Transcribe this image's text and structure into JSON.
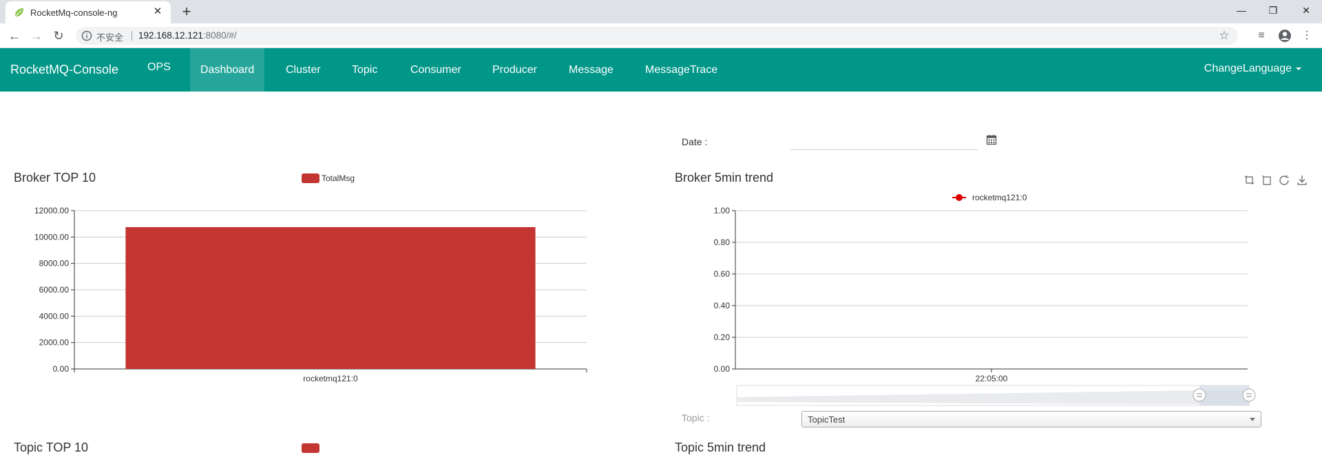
{
  "browser": {
    "tab_title": "RocketMq-console-ng",
    "url_insecure_label": "不安全",
    "url_host": "192.168.12.121",
    "url_path": ":8080/#/"
  },
  "navbar": {
    "brand": "RocketMQ-Console",
    "items": [
      {
        "label": "OPS"
      },
      {
        "label": "Dashboard",
        "active": true
      },
      {
        "label": "Cluster"
      },
      {
        "label": "Topic"
      },
      {
        "label": "Consumer"
      },
      {
        "label": "Producer"
      },
      {
        "label": "Message"
      },
      {
        "label": "MessageTrace"
      }
    ],
    "language": "ChangeLanguage"
  },
  "date_filter": {
    "label": "Date :",
    "value": ""
  },
  "topic_filter": {
    "label": "Topic :",
    "selected": "TopicTest"
  },
  "colors": {
    "navbar": "#009688",
    "navbar_active": "#26a69a",
    "bar": "#c23531",
    "trend_line": "#e00000"
  },
  "chart_data": [
    {
      "type": "bar",
      "title": "Broker TOP 10",
      "legend": [
        "TotalMsg"
      ],
      "categories": [
        "rocketmq121:0"
      ],
      "series": [
        {
          "name": "TotalMsg",
          "values": [
            10750
          ]
        }
      ],
      "ylim": [
        0,
        12000
      ],
      "yticks": [
        "0.00",
        "2000.00",
        "4000.00",
        "6000.00",
        "8000.00",
        "10000.00",
        "12000.00"
      ],
      "grid": true
    },
    {
      "type": "line",
      "title": "Broker 5min trend",
      "legend": [
        "rocketmq121:0"
      ],
      "x": [
        "22:05:00"
      ],
      "series": [
        {
          "name": "rocketmq121:0",
          "values": []
        }
      ],
      "ylim": [
        0,
        1
      ],
      "yticks": [
        "0.00",
        "0.20",
        "0.40",
        "0.60",
        "0.80",
        "1.00"
      ],
      "grid": true,
      "datazoom": true
    },
    {
      "type": "bar",
      "title": "Topic TOP 10",
      "partially_visible": true
    },
    {
      "type": "line",
      "title": "Topic 5min trend",
      "partially_visible": true
    }
  ]
}
